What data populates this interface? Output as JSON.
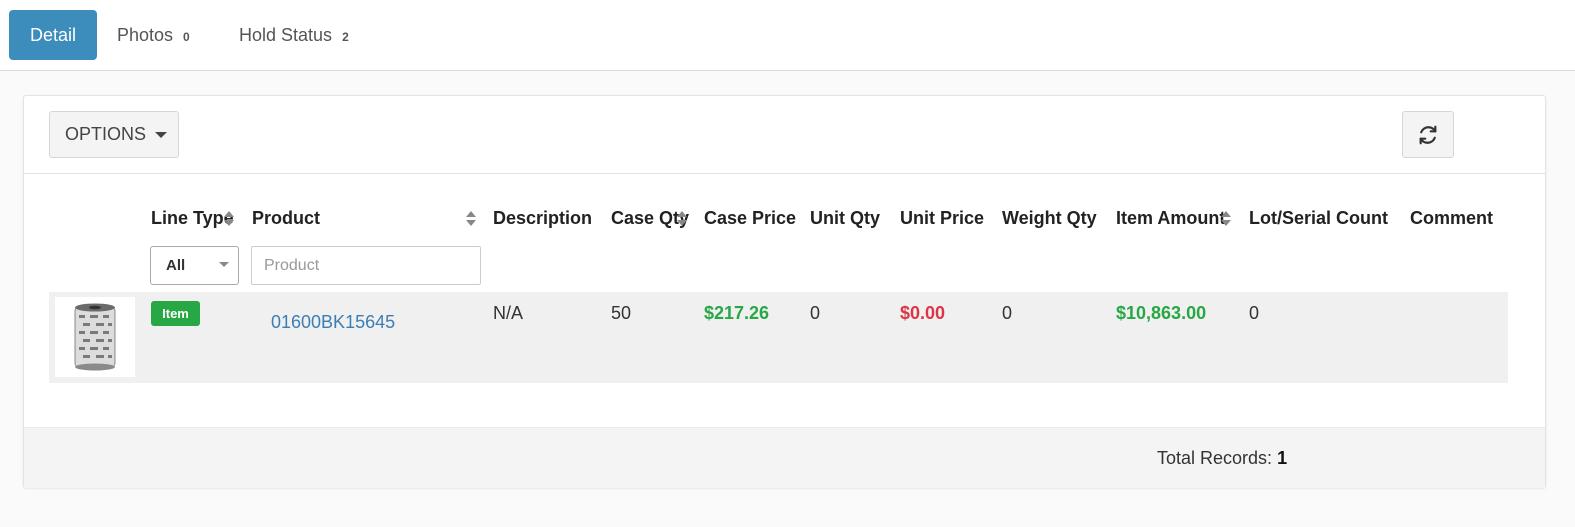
{
  "tabs": [
    {
      "label": "Detail",
      "count": null,
      "active": true
    },
    {
      "label": "Photos",
      "count": "0",
      "active": false
    },
    {
      "label": "Hold Status",
      "count": "2",
      "active": false
    }
  ],
  "toolbar": {
    "options_label": "OPTIONS",
    "options_icon": "caret-down-icon",
    "refresh_icon": "refresh-icon"
  },
  "table": {
    "columns": [
      "Line Type",
      "Product",
      "Description",
      "Case Qty",
      "Case Price",
      "Unit Qty",
      "Unit Price",
      "Weight Qty",
      "Item Amount",
      "Lot/Serial Count",
      "Comment"
    ],
    "filters": {
      "line_type_selected": "All",
      "product_placeholder": "Product"
    },
    "rows": [
      {
        "thumbnail_icon": "ribbon-roll-image",
        "line_type": "Item",
        "product": "01600BK15645",
        "description": "N/A",
        "case_qty": "50",
        "case_price": "$217.26",
        "unit_qty": "0",
        "unit_price": "$0.00",
        "weight_qty": "0",
        "item_amount": "$10,863.00",
        "lot_serial_count": "0",
        "comment": ""
      }
    ]
  },
  "footer": {
    "total_label": "Total Records:",
    "total_value": "1"
  },
  "colors": {
    "accent": "#3c8dbc",
    "positive": "#28a745",
    "negative": "#dc3545",
    "link": "#3c7db5"
  }
}
